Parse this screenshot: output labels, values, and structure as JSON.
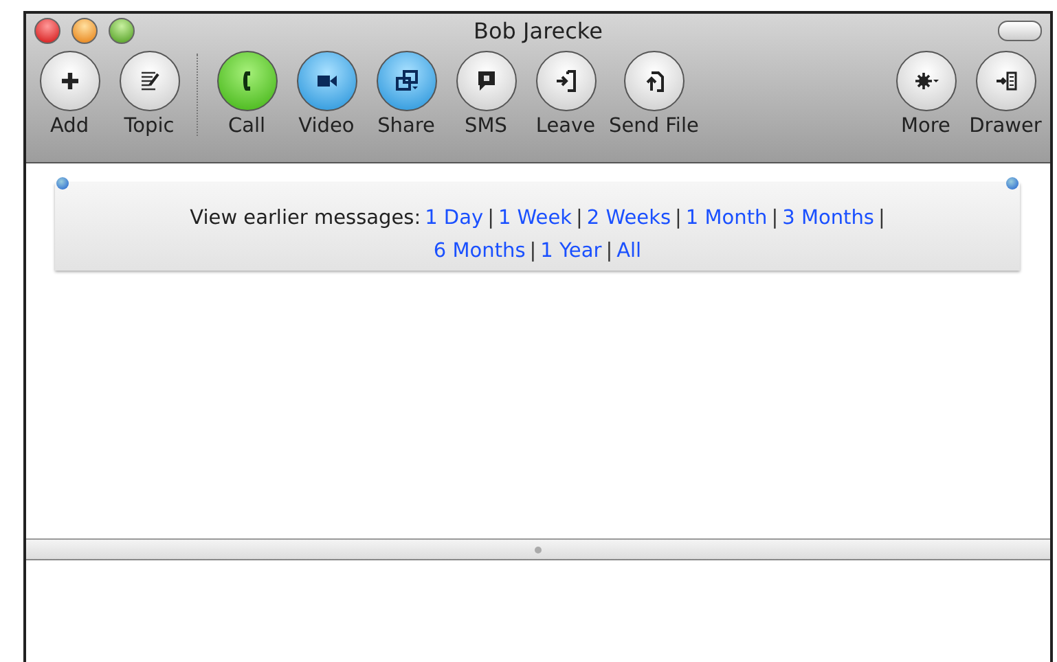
{
  "window": {
    "title": "Bob Jarecke"
  },
  "toolbar": {
    "groups": [
      {
        "buttons": [
          {
            "label": "Add",
            "kind": "plus"
          },
          {
            "label": "Topic",
            "kind": "note"
          }
        ]
      },
      {
        "buttons": [
          {
            "label": "Call",
            "kind": "phone"
          },
          {
            "label": "Video",
            "kind": "camera"
          },
          {
            "label": "Share",
            "kind": "share"
          },
          {
            "label": "SMS",
            "kind": "sms"
          },
          {
            "label": "Leave",
            "kind": "leave"
          },
          {
            "label": "Send File",
            "kind": "file"
          }
        ]
      },
      {
        "buttons": [
          {
            "label": "More",
            "kind": "gear"
          },
          {
            "label": "Drawer",
            "kind": "drawer"
          }
        ]
      }
    ]
  },
  "history_banner": {
    "lines": [
      [
        {
          "kind": "text",
          "text": "View earlier messages:"
        },
        {
          "kind": "link",
          "text": "1 Day"
        },
        {
          "kind": "sep",
          "text": "|"
        },
        {
          "kind": "link",
          "text": "1 Week"
        },
        {
          "kind": "sep",
          "text": "|"
        },
        {
          "kind": "link",
          "text": "2 Weeks"
        },
        {
          "kind": "sep",
          "text": "|"
        },
        {
          "kind": "link",
          "text": "1 Month"
        },
        {
          "kind": "sep",
          "text": "|"
        },
        {
          "kind": "link",
          "text": "3 Months"
        },
        {
          "kind": "sep",
          "text": "|"
        }
      ],
      [
        {
          "kind": "link",
          "text": "6 Months"
        },
        {
          "kind": "sep",
          "text": "|"
        },
        {
          "kind": "link",
          "text": "1 Year"
        },
        {
          "kind": "sep",
          "text": "|"
        },
        {
          "kind": "link",
          "text": "All"
        }
      ]
    ]
  }
}
